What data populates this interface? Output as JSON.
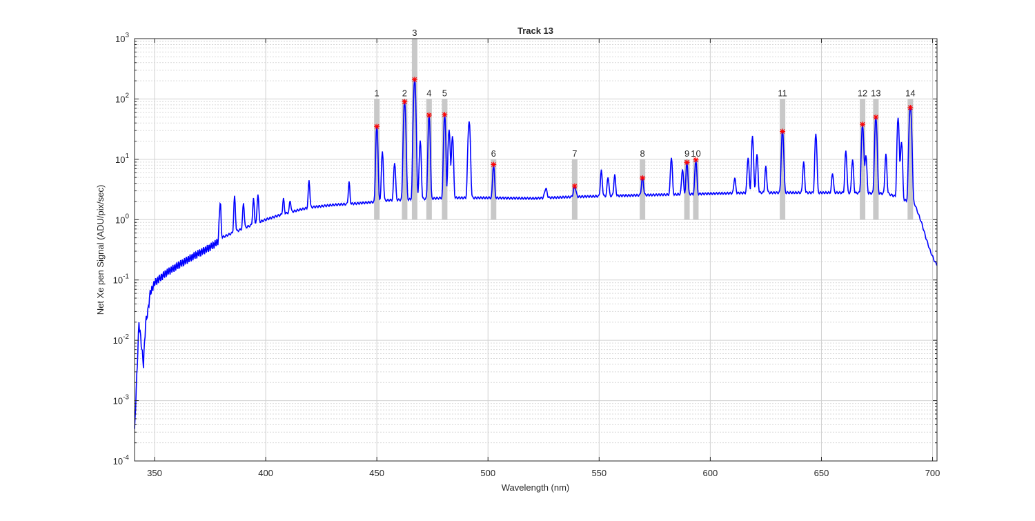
{
  "chart_data": {
    "type": "line",
    "title": "Track 13",
    "xlabel": "Wavelength (nm)",
    "ylabel": "Net Xe pen Signal (ADU/pix/sec)",
    "xlim": [
      341,
      702
    ],
    "ylim": [
      0.0001,
      1000
    ],
    "yscale": "log",
    "grid": "on",
    "x_ticks": [
      350,
      400,
      450,
      500,
      550,
      600,
      650,
      700
    ],
    "x_tick_labels": [
      "350",
      "400",
      "450",
      "500",
      "550",
      "600",
      "650",
      "700"
    ],
    "y_ticks": [
      0.0001,
      0.001,
      0.01,
      0.1,
      1,
      10,
      100,
      1000
    ],
    "y_tick_labels": [
      {
        "base": "10",
        "exp": "-4"
      },
      {
        "base": "10",
        "exp": "-3"
      },
      {
        "base": "10",
        "exp": "-2"
      },
      {
        "base": "10",
        "exp": "-1"
      },
      {
        "base": "10",
        "exp": "0"
      },
      {
        "base": "10",
        "exp": "1"
      },
      {
        "base": "10",
        "exp": "2"
      },
      {
        "base": "10",
        "exp": "3"
      }
    ],
    "series_color": "#0000ff",
    "marker_color": "#ff0000",
    "band_color": "#c8c8c8",
    "baseline": [
      [
        341,
        0.0003
      ],
      [
        343,
        0.02
      ],
      [
        345,
        0.004
      ],
      [
        346,
        0.02
      ],
      [
        347,
        0.03
      ],
      [
        348,
        0.06
      ],
      [
        350,
        0.09
      ],
      [
        355,
        0.13
      ],
      [
        360,
        0.17
      ],
      [
        365,
        0.22
      ],
      [
        370,
        0.28
      ],
      [
        375,
        0.35
      ],
      [
        378,
        0.42
      ],
      [
        380,
        0.5
      ],
      [
        385,
        0.6
      ],
      [
        390,
        0.72
      ],
      [
        395,
        0.85
      ],
      [
        400,
        1.0
      ],
      [
        405,
        1.15
      ],
      [
        410,
        1.3
      ],
      [
        415,
        1.45
      ],
      [
        420,
        1.6
      ],
      [
        430,
        1.75
      ],
      [
        440,
        1.85
      ],
      [
        448,
        1.95
      ],
      [
        455,
        2.1
      ],
      [
        470,
        2.2
      ],
      [
        480,
        2.3
      ],
      [
        490,
        2.3
      ],
      [
        500,
        2.3
      ],
      [
        520,
        2.25
      ],
      [
        540,
        2.4
      ],
      [
        560,
        2.5
      ],
      [
        580,
        2.6
      ],
      [
        600,
        2.7
      ],
      [
        620,
        2.8
      ],
      [
        640,
        2.8
      ],
      [
        660,
        2.8
      ],
      [
        680,
        2.7
      ],
      [
        692,
        1.8
      ],
      [
        695,
        0.9
      ],
      [
        697,
        0.5
      ],
      [
        699,
        0.3
      ],
      [
        701,
        0.2
      ],
      [
        702,
        0.18
      ]
    ],
    "lines": [
      [
        379.5,
        2.0,
        0.3
      ],
      [
        386,
        2.4,
        0.3
      ],
      [
        390,
        1.9,
        0.3
      ],
      [
        394.5,
        2.2,
        0.3
      ],
      [
        396.5,
        2.7,
        0.3
      ],
      [
        408,
        2.2,
        0.3
      ],
      [
        411,
        2.1,
        0.3
      ],
      [
        419.5,
        4.5,
        0.3
      ],
      [
        437.5,
        4.2,
        0.3
      ],
      [
        450,
        35,
        0.35
      ],
      [
        452.5,
        13,
        0.35
      ],
      [
        458,
        9,
        0.35
      ],
      [
        462.5,
        90,
        0.4
      ],
      [
        467,
        210,
        0.4
      ],
      [
        469.5,
        20,
        0.35
      ],
      [
        473.5,
        54,
        0.35
      ],
      [
        480.5,
        55,
        0.35
      ],
      [
        482.5,
        32,
        0.35
      ],
      [
        484,
        25,
        0.35
      ],
      [
        491.5,
        43,
        0.4
      ],
      [
        502.5,
        8.2,
        0.35
      ],
      [
        526,
        3.3,
        0.5
      ],
      [
        539,
        3.6,
        0.5
      ],
      [
        551,
        6.5,
        0.35
      ],
      [
        554,
        5.2,
        0.35
      ],
      [
        557,
        5.5,
        0.35
      ],
      [
        569.5,
        5.0,
        0.4
      ],
      [
        582.5,
        11,
        0.35
      ],
      [
        587.5,
        7,
        0.35
      ],
      [
        589.5,
        9.0,
        0.35
      ],
      [
        593.5,
        10,
        0.35
      ],
      [
        611,
        5,
        0.35
      ],
      [
        617,
        11,
        0.35
      ],
      [
        619,
        24,
        0.35
      ],
      [
        621,
        12,
        0.35
      ],
      [
        625,
        7.5,
        0.35
      ],
      [
        632.5,
        30,
        0.4
      ],
      [
        642,
        9,
        0.35
      ],
      [
        647.5,
        27,
        0.35
      ],
      [
        655,
        6,
        0.35
      ],
      [
        661,
        14,
        0.35
      ],
      [
        664,
        10,
        0.35
      ],
      [
        668.5,
        38,
        0.4
      ],
      [
        670,
        12,
        0.35
      ],
      [
        674.5,
        50,
        0.4
      ],
      [
        679,
        12,
        0.35
      ],
      [
        684.5,
        50,
        0.35
      ],
      [
        686,
        20,
        0.35
      ],
      [
        690,
        75,
        0.45
      ]
    ],
    "peaks": [
      {
        "label": "1",
        "x": 450,
        "y": 35
      },
      {
        "label": "2",
        "x": 462.5,
        "y": 90
      },
      {
        "label": "3",
        "x": 467,
        "y": 210
      },
      {
        "label": "4",
        "x": 473.5,
        "y": 54
      },
      {
        "label": "5",
        "x": 480.5,
        "y": 55
      },
      {
        "label": "6",
        "x": 502.5,
        "y": 8.2
      },
      {
        "label": "7",
        "x": 539,
        "y": 3.6
      },
      {
        "label": "8",
        "x": 569.5,
        "y": 4.9
      },
      {
        "label": "9",
        "x": 589.5,
        "y": 8.9
      },
      {
        "label": "10",
        "x": 593.5,
        "y": 9.8
      },
      {
        "label": "11",
        "x": 632.5,
        "y": 29
      },
      {
        "label": "12",
        "x": 668.5,
        "y": 38
      },
      {
        "label": "13",
        "x": 674.5,
        "y": 50
      },
      {
        "label": "14",
        "x": 690,
        "y": 72
      }
    ]
  }
}
